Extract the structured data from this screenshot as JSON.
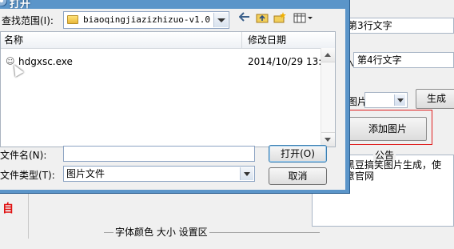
{
  "background": {
    "field_line3": "第3行文字",
    "field_line4_prefix": "入",
    "field_line4": "第4行文字",
    "image_label": "图片",
    "generate_button": "生成",
    "add_image_button": "添加图片",
    "notice_title": "公告",
    "notice_text": "明黑豆搞笑图片生成，使\n留意官网",
    "font_group_title": "字体颜色  大小  设置区",
    "red_text": "自"
  },
  "dialog": {
    "title": "打开",
    "look_in_label": "查找范围(I):",
    "look_in_value": "biaoqingjiazizhizuo-v1.0",
    "toolbar": {
      "back_icon": "back-arrow-icon",
      "up_folder_icon": "up-folder-icon",
      "new_folder_icon": "new-folder-icon",
      "view_menu_icon": "view-menu-icon"
    },
    "columns": {
      "name": "名称",
      "modified": "修改日期"
    },
    "files": [
      {
        "name": "hdgxsc.exe",
        "modified": "2014/10/29 13:17"
      }
    ],
    "file_name_label": "文件名(N):",
    "file_name_value": "",
    "file_type_label": "文件类型(T):",
    "file_type_value": "图片文件",
    "open_button": "打开(O)",
    "cancel_button": "取消"
  }
}
